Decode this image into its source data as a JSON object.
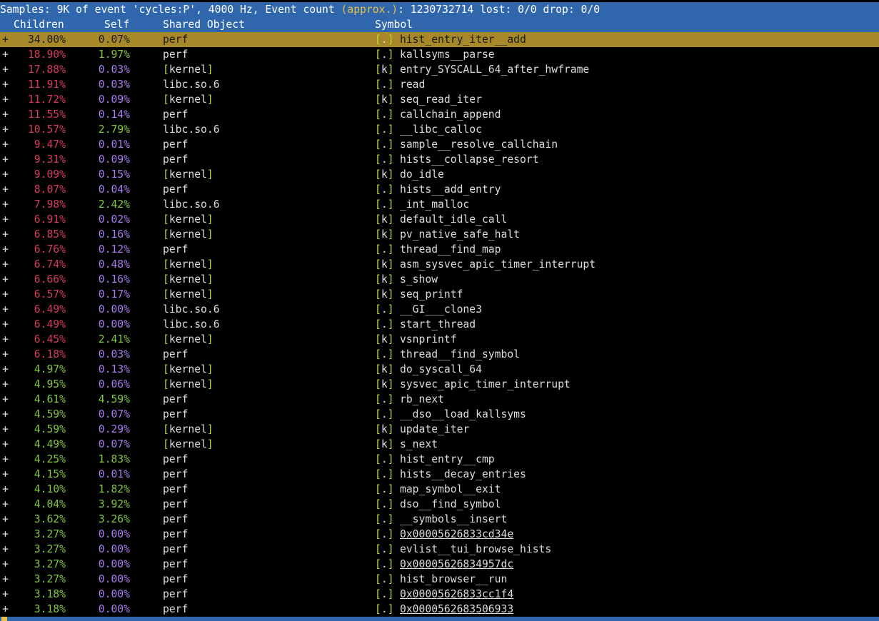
{
  "status_bar": {
    "prefix": "Samples: 9K of event 'cycles:P', 4000 Hz, Event count ",
    "paren": "(approx.)",
    "suffix": ": 1230732714 lost: 0/0 drop: 0/0"
  },
  "header": {
    "children": "Children",
    "self": "Self",
    "shared_object": "Shared Object",
    "symbol": "Symbol"
  },
  "colors": {
    "high": "#d83b5e",
    "mid": "#83c740",
    "low": "#a87ef0",
    "selection": "#a8892a",
    "bar": "#2f66ac"
  },
  "rows": [
    {
      "children": "34.00%",
      "self": "0.07%",
      "object": "perf",
      "tag": "[.]",
      "symbol": "hist_entry_iter__add"
    },
    {
      "children": "18.90%",
      "self": "1.97%",
      "object": "perf",
      "tag": "[.]",
      "symbol": "kallsyms__parse"
    },
    {
      "children": "17.88%",
      "self": "0.03%",
      "object": "[kernel]",
      "tag": "[k]",
      "symbol": "entry_SYSCALL_64_after_hwframe"
    },
    {
      "children": "11.91%",
      "self": "0.03%",
      "object": "libc.so.6",
      "tag": "[.]",
      "symbol": "read"
    },
    {
      "children": "11.72%",
      "self": "0.09%",
      "object": "[kernel]",
      "tag": "[k]",
      "symbol": "seq_read_iter"
    },
    {
      "children": "11.55%",
      "self": "0.14%",
      "object": "perf",
      "tag": "[.]",
      "symbol": "callchain_append"
    },
    {
      "children": "10.57%",
      "self": "2.79%",
      "object": "libc.so.6",
      "tag": "[.]",
      "symbol": "__libc_calloc"
    },
    {
      "children": "9.47%",
      "self": "0.01%",
      "object": "perf",
      "tag": "[.]",
      "symbol": "sample__resolve_callchain"
    },
    {
      "children": "9.31%",
      "self": "0.09%",
      "object": "perf",
      "tag": "[.]",
      "symbol": "hists__collapse_resort"
    },
    {
      "children": "9.09%",
      "self": "0.15%",
      "object": "[kernel]",
      "tag": "[k]",
      "symbol": "do_idle"
    },
    {
      "children": "8.07%",
      "self": "0.04%",
      "object": "perf",
      "tag": "[.]",
      "symbol": "hists__add_entry"
    },
    {
      "children": "7.98%",
      "self": "2.42%",
      "object": "libc.so.6",
      "tag": "[.]",
      "symbol": "_int_malloc"
    },
    {
      "children": "6.91%",
      "self": "0.02%",
      "object": "[kernel]",
      "tag": "[k]",
      "symbol": "default_idle_call"
    },
    {
      "children": "6.85%",
      "self": "0.16%",
      "object": "[kernel]",
      "tag": "[k]",
      "symbol": "pv_native_safe_halt"
    },
    {
      "children": "6.76%",
      "self": "0.12%",
      "object": "perf",
      "tag": "[.]",
      "symbol": "thread__find_map"
    },
    {
      "children": "6.74%",
      "self": "0.48%",
      "object": "[kernel]",
      "tag": "[k]",
      "symbol": "asm_sysvec_apic_timer_interrupt"
    },
    {
      "children": "6.66%",
      "self": "0.16%",
      "object": "[kernel]",
      "tag": "[k]",
      "symbol": "s_show"
    },
    {
      "children": "6.57%",
      "self": "0.17%",
      "object": "[kernel]",
      "tag": "[k]",
      "symbol": "seq_printf"
    },
    {
      "children": "6.49%",
      "self": "0.00%",
      "object": "libc.so.6",
      "tag": "[.]",
      "symbol": "__GI___clone3"
    },
    {
      "children": "6.49%",
      "self": "0.00%",
      "object": "libc.so.6",
      "tag": "[.]",
      "symbol": "start_thread"
    },
    {
      "children": "6.45%",
      "self": "2.41%",
      "object": "[kernel]",
      "tag": "[k]",
      "symbol": "vsnprintf"
    },
    {
      "children": "6.18%",
      "self": "0.03%",
      "object": "perf",
      "tag": "[.]",
      "symbol": "thread__find_symbol"
    },
    {
      "children": "4.97%",
      "self": "0.13%",
      "object": "[kernel]",
      "tag": "[k]",
      "symbol": "do_syscall_64"
    },
    {
      "children": "4.95%",
      "self": "0.06%",
      "object": "[kernel]",
      "tag": "[k]",
      "symbol": "sysvec_apic_timer_interrupt"
    },
    {
      "children": "4.61%",
      "self": "4.59%",
      "object": "perf",
      "tag": "[.]",
      "symbol": "rb_next"
    },
    {
      "children": "4.59%",
      "self": "0.07%",
      "object": "perf",
      "tag": "[.]",
      "symbol": "__dso__load_kallsyms"
    },
    {
      "children": "4.59%",
      "self": "0.29%",
      "object": "[kernel]",
      "tag": "[k]",
      "symbol": "update_iter"
    },
    {
      "children": "4.49%",
      "self": "0.07%",
      "object": "[kernel]",
      "tag": "[k]",
      "symbol": "s_next"
    },
    {
      "children": "4.25%",
      "self": "1.83%",
      "object": "perf",
      "tag": "[.]",
      "symbol": "hist_entry__cmp"
    },
    {
      "children": "4.15%",
      "self": "0.01%",
      "object": "perf",
      "tag": "[.]",
      "symbol": "hists__decay_entries"
    },
    {
      "children": "4.10%",
      "self": "1.82%",
      "object": "perf",
      "tag": "[.]",
      "symbol": "map_symbol__exit"
    },
    {
      "children": "4.04%",
      "self": "3.92%",
      "object": "perf",
      "tag": "[.]",
      "symbol": "dso__find_symbol"
    },
    {
      "children": "3.62%",
      "self": "3.26%",
      "object": "perf",
      "tag": "[.]",
      "symbol": "__symbols__insert"
    },
    {
      "children": "3.27%",
      "self": "0.00%",
      "object": "perf",
      "tag": "[.]",
      "symbol": "0x00005626833cd34e"
    },
    {
      "children": "3.27%",
      "self": "0.00%",
      "object": "perf",
      "tag": "[.]",
      "symbol": "evlist__tui_browse_hists"
    },
    {
      "children": "3.27%",
      "self": "0.00%",
      "object": "perf",
      "tag": "[.]",
      "symbol": "0x00005626834957dc"
    },
    {
      "children": "3.27%",
      "self": "0.00%",
      "object": "perf",
      "tag": "[.]",
      "symbol": "hist_browser__run"
    },
    {
      "children": "3.18%",
      "self": "0.00%",
      "object": "perf",
      "tag": "[.]",
      "symbol": "0x00005626833cc1f4"
    },
    {
      "children": "3.18%",
      "self": "0.00%",
      "object": "perf",
      "tag": "[.]",
      "symbol": "0x0000562683506933"
    }
  ]
}
